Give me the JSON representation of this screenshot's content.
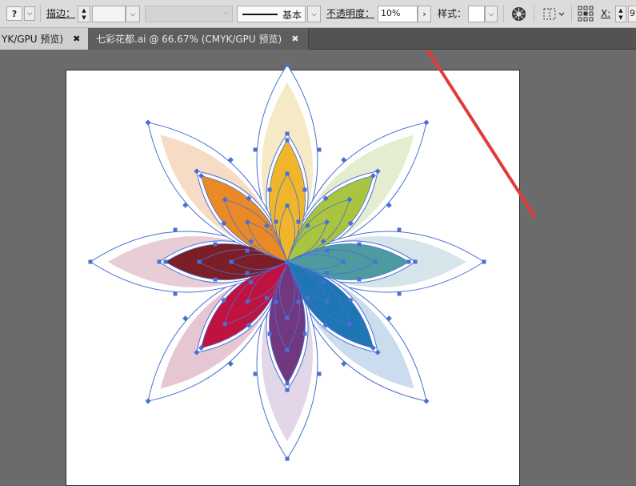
{
  "toolbar": {
    "fill_label": "?",
    "stroke_label": "描边：",
    "stroke_style_label": "基本",
    "opacity_label": "不透明度：",
    "opacity_value": "10%",
    "style_label": "样式：",
    "x_label": "X:",
    "x_value": "9"
  },
  "tabs": [
    {
      "label": "YK/GPU 预览)",
      "close": "✖",
      "active": true
    },
    {
      "label": "七彩花都.ai @ 66.67% (CMYK/GPU 预览)",
      "close": "✖",
      "active": false
    }
  ],
  "colors": {
    "outer_petals": [
      "#f6e9c6",
      "#e4edd0",
      "#d6e5ea",
      "#cadcee",
      "#e2d6e8",
      "#e7c6d3",
      "#e8cdd6",
      "#f6dcc4"
    ],
    "inner_petals": [
      "#f0b62b",
      "#a9c43e",
      "#4e9aa1",
      "#1e76b4",
      "#71387f",
      "#c0123f",
      "#7c1e26",
      "#e98a26"
    ],
    "selection": "#4a6fd4",
    "arrow": "#e33b3b"
  }
}
